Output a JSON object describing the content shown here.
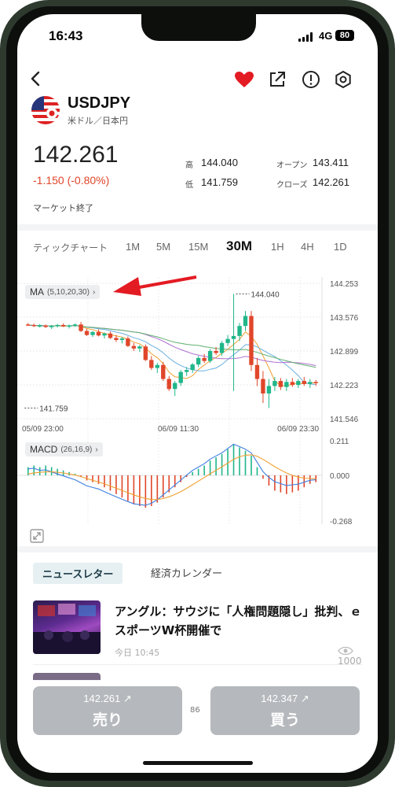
{
  "status": {
    "time": "16:43",
    "network": "4G",
    "battery": "80"
  },
  "instrument": {
    "symbol": "USDJPY",
    "subtitle": "米ドル／日本円",
    "price": "142.261",
    "change": "-1.150 (-0.80%)",
    "market_status": "マーケット終了",
    "stats": [
      {
        "label": "高",
        "value": "144.040"
      },
      {
        "label": "オープン",
        "value": "143.411"
      },
      {
        "label": "低",
        "value": "141.759"
      },
      {
        "label": "クローズ",
        "value": "142.261"
      }
    ]
  },
  "timeframes": {
    "tick": "ティックチャート",
    "items": [
      "1M",
      "5M",
      "15M",
      "30M",
      "1H",
      "4H",
      "1D"
    ],
    "active": "30M"
  },
  "chart": {
    "ma_label": "MA",
    "ma_params": "(5,10,20,30)",
    "macd_label": "MACD",
    "macd_params": "(26,16,9)",
    "price_ticks": [
      "144.253",
      "143.576",
      "142.899",
      "142.223",
      "141.546"
    ],
    "macd_ticks": [
      "0.211",
      "0.000",
      "-0.268"
    ],
    "high_marker": "144.040",
    "low_marker": "141.759",
    "time_labels": [
      "05/09 23:00",
      "06/09 11:30",
      "06/09 23:30"
    ],
    "colors": {
      "up": "#1fb68a",
      "down": "#e0462a",
      "arrow": "#e31b23"
    }
  },
  "chart_data": {
    "type": "candlestick",
    "ylim": [
      141.546,
      144.253
    ],
    "ohlc": [
      [
        143.43,
        143.46,
        143.4,
        143.42
      ],
      [
        143.42,
        143.45,
        143.38,
        143.4
      ],
      [
        143.4,
        143.44,
        143.37,
        143.41
      ],
      [
        143.41,
        143.43,
        143.36,
        143.38
      ],
      [
        143.38,
        143.42,
        143.34,
        143.4
      ],
      [
        143.4,
        143.44,
        143.37,
        143.42
      ],
      [
        143.42,
        143.45,
        143.38,
        143.39
      ],
      [
        143.39,
        143.43,
        143.35,
        143.41
      ],
      [
        143.41,
        143.45,
        143.38,
        143.43
      ],
      [
        143.43,
        143.48,
        143.28,
        143.3
      ],
      [
        143.3,
        143.34,
        143.2,
        143.22
      ],
      [
        143.22,
        143.3,
        143.18,
        143.28
      ],
      [
        143.28,
        143.33,
        143.19,
        143.21
      ],
      [
        143.21,
        143.27,
        143.15,
        143.25
      ],
      [
        143.25,
        143.29,
        143.14,
        143.16
      ],
      [
        143.16,
        143.22,
        143.08,
        143.12
      ],
      [
        143.12,
        143.18,
        143.05,
        143.15
      ],
      [
        143.15,
        143.19,
        142.98,
        143.0
      ],
      [
        143.0,
        143.06,
        142.9,
        142.95
      ],
      [
        142.95,
        143.02,
        142.88,
        142.99
      ],
      [
        142.99,
        143.03,
        142.7,
        142.72
      ],
      [
        142.72,
        142.8,
        142.52,
        142.56
      ],
      [
        142.56,
        142.66,
        142.46,
        142.62
      ],
      [
        142.62,
        142.68,
        142.3,
        142.34
      ],
      [
        142.34,
        142.4,
        142.1,
        142.14
      ],
      [
        142.14,
        142.3,
        142.0,
        142.26
      ],
      [
        142.26,
        142.52,
        142.2,
        142.48
      ],
      [
        142.48,
        142.58,
        142.4,
        142.52
      ],
      [
        142.52,
        142.66,
        142.46,
        142.63
      ],
      [
        142.63,
        142.8,
        142.58,
        142.76
      ],
      [
        142.76,
        142.84,
        142.66,
        142.7
      ],
      [
        142.7,
        142.94,
        142.66,
        142.9
      ],
      [
        142.9,
        142.98,
        142.82,
        142.86
      ],
      [
        142.86,
        143.1,
        142.8,
        143.06
      ],
      [
        143.06,
        143.22,
        143.0,
        143.14
      ],
      [
        143.14,
        144.04,
        142.1,
        143.2
      ],
      [
        143.2,
        143.46,
        143.1,
        143.4
      ],
      [
        143.4,
        143.7,
        143.3,
        143.6
      ],
      [
        143.6,
        143.7,
        142.5,
        142.62
      ],
      [
        142.62,
        142.76,
        142.2,
        142.34
      ],
      [
        142.34,
        142.5,
        141.86,
        142.05
      ],
      [
        142.05,
        142.34,
        141.76,
        142.2
      ],
      [
        142.2,
        142.38,
        142.1,
        142.3
      ],
      [
        142.3,
        142.36,
        142.12,
        142.18
      ],
      [
        142.18,
        142.34,
        142.1,
        142.28
      ],
      [
        142.28,
        142.36,
        142.18,
        142.22
      ],
      [
        142.22,
        142.34,
        142.16,
        142.3
      ],
      [
        142.3,
        142.38,
        142.2,
        142.24
      ],
      [
        142.24,
        142.34,
        142.16,
        142.28
      ],
      [
        142.28,
        142.32,
        142.2,
        142.26
      ]
    ],
    "macd_hist": [
      0.05,
      0.06,
      0.05,
      0.06,
      0.05,
      0.04,
      0.03,
      0.02,
      0.01,
      -0.01,
      -0.03,
      -0.04,
      -0.05,
      -0.07,
      -0.09,
      -0.11,
      -0.13,
      -0.15,
      -0.17,
      -0.18,
      -0.19,
      -0.18,
      -0.16,
      -0.13,
      -0.1,
      -0.07,
      -0.04,
      -0.01,
      0.02,
      0.04,
      0.06,
      0.09,
      0.11,
      0.13,
      0.16,
      0.19,
      0.17,
      0.15,
      0.12,
      0.05,
      -0.02,
      -0.06,
      -0.09,
      -0.1,
      -0.11,
      -0.1,
      -0.09,
      -0.07,
      -0.05,
      -0.04
    ]
  },
  "news": {
    "tabs": [
      "ニュースレター",
      "経済カレンダー"
    ],
    "items": [
      {
        "title": "アングル：サウジに「人権問題隠し」批判、ｅスポーツW杯開催で",
        "date": "今日 10:45",
        "views": "1000"
      }
    ]
  },
  "trade": {
    "sell_price": "142.261",
    "sell_label": "売り",
    "buy_price": "142.347",
    "buy_label": "買う",
    "spread": "86"
  }
}
